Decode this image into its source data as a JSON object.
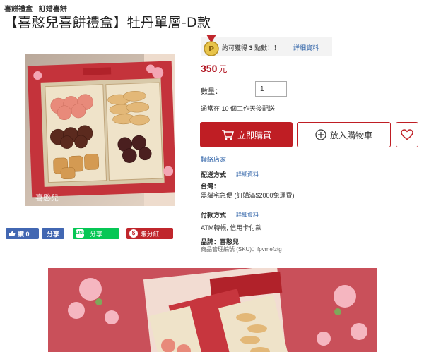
{
  "breadcrumb": [
    "喜餅禮盒",
    "訂婚喜餅"
  ],
  "product": {
    "title": "【喜憨兒喜餅禮盒】牡丹單層-D款",
    "price": "350",
    "price_unit": "元"
  },
  "points": {
    "text_prefix": "約可獲得",
    "amount": "3",
    "text_suffix": "點數！！",
    "link": "詳細資料"
  },
  "quantity": {
    "label": "數量：",
    "value": "1"
  },
  "shipping_note": "通常在 10 個工作天後配送",
  "actions": {
    "buy": "立即購買",
    "add_to_cart": "放入購物車"
  },
  "contact_store": "聯絡店家",
  "delivery": {
    "label": "配送方式",
    "link": "詳細資料",
    "region": "台灣：",
    "method": "黑貓宅急便 (訂購滿$2000免運費)"
  },
  "payment": {
    "label": "付款方式",
    "link": "詳細資料",
    "methods": "ATM轉帳, 信用卡付款"
  },
  "brand": {
    "label": "品牌：",
    "name": "喜憨兒",
    "sku_label": "商品管理編號 (SKU)：",
    "sku": "fpvmefztg"
  },
  "social": {
    "like": "讚 0",
    "share": "分享",
    "line": "分享",
    "earn": "賺分紅"
  },
  "image_watermark": "喜憨兒",
  "colors": {
    "accent": "#bf1e24",
    "link": "#2a5fa6",
    "price": "#b0101d",
    "facebook": "#4267b2",
    "line": "#06c755"
  }
}
